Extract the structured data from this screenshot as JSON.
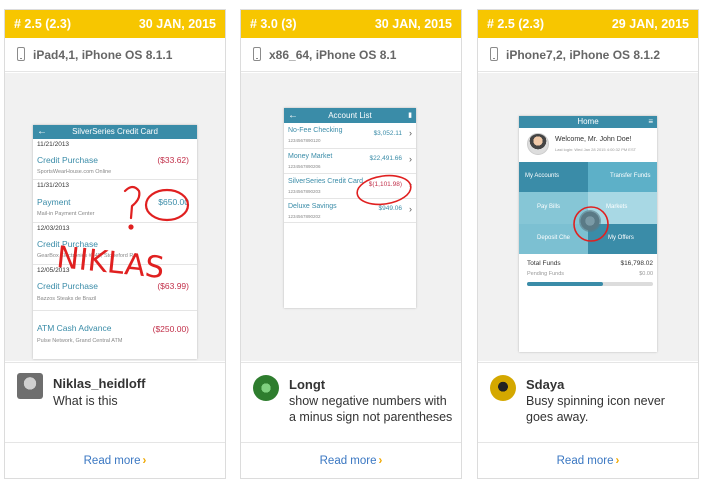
{
  "cards": [
    {
      "version": "# 2.5 (2.3)",
      "date": "30 JAN, 2015",
      "device": "iPad4,1, iPhone OS 8.1.1",
      "screenshot": {
        "navbar_title": "SilverSeries Credit Card",
        "rows": [
          {
            "date": "11/21/2013",
            "title": "Credit Purchase",
            "amount": "($33.62)",
            "sub": "SportsWearHouse.com Online"
          },
          {
            "date": "11/31/2013",
            "title": "Payment",
            "amount": "$650.00",
            "sub": "Mail-in Payment Center"
          },
          {
            "date": "12/03/2013",
            "title": "Credit Purchase",
            "amount": "",
            "sub": "GearBox Electronics #345, Stoneford Rd"
          },
          {
            "date": "12/05/2013",
            "title": "Credit Purchase",
            "amount": "($63.99)",
            "sub": "Bazzos Steaks de Brazil"
          },
          {
            "date": "",
            "title": "ATM Cash Advance",
            "amount": "($250.00)",
            "sub": "Pulse Network, Grand Central ATM"
          }
        ],
        "handwriting": "NIKLAS"
      },
      "username": "Niklas_heidloff",
      "comment": "What is this",
      "avatar_color": "#7a7a7a"
    },
    {
      "version": "# 3.0 (3)",
      "date": "30 JAN, 2015",
      "device": "x86_64, iPhone OS 8.1",
      "screenshot": {
        "navbar_title": "Account List",
        "accounts": [
          {
            "name": "No-Fee Checking",
            "number": "1234567890120",
            "amount": "$3,052.11"
          },
          {
            "name": "Money Market",
            "number": "1234567890206",
            "amount": "$22,491.66"
          },
          {
            "name": "SilverSeries Credit Card",
            "number": "1234567890203",
            "amount": "$(1,101.98)"
          },
          {
            "name": "Deluxe Savings",
            "number": "1234567890202",
            "amount": "$949.06"
          }
        ]
      },
      "username": "Longt",
      "comment": "show negative numbers with a minus sign not parentheses",
      "avatar_color": "#4aa04a"
    },
    {
      "version": "# 2.5 (2.3)",
      "date": "29 JAN, 2015",
      "device": "iPhone7,2, iPhone OS 8.1.2",
      "screenshot": {
        "navbar_title": "Home",
        "welcome": "Welcome, Mr. John Doe!",
        "last_login": "Last login: Wed Jan 28 2015 4:00:32 PM EST",
        "tiles": [
          "My Accounts",
          "Transfer Funds",
          "Pay Bills",
          "Markets",
          "Deposit Che",
          "My Offers"
        ],
        "total_label": "Total Funds",
        "total_value": "$16,798.02",
        "pending_label": "Pending Funds",
        "pending_value": "$0.00",
        "progress": 0.6
      },
      "username": "Sdaya",
      "comment": "Busy spinning icon never goes away.",
      "avatar_color": "#c8a000"
    }
  ],
  "read_more_label": "Read more",
  "colors": {
    "header": "#f7c600",
    "link": "#3a77c2",
    "teal": "#3a8ca8",
    "negative": "#c2304a",
    "annotation": "#e02020"
  }
}
